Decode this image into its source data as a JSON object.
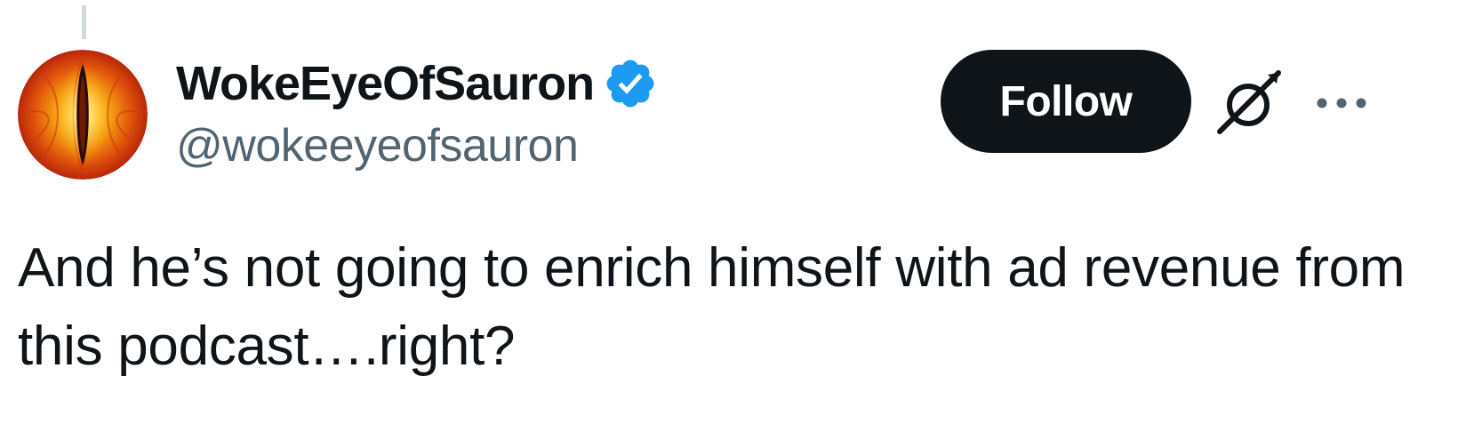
{
  "tweet": {
    "author": {
      "display_name": "WokeEyeOfSauron",
      "handle": "@wokeeyeofsauron",
      "verified": true,
      "avatar_icon": "eye-of-sauron-avatar"
    },
    "actions": {
      "follow_label": "Follow",
      "grok_icon": "grok-icon",
      "more_icon": "more-options-icon"
    },
    "text": "And he’s not going to enrich himself with ad revenue from this podcast….right?"
  },
  "colors": {
    "text_primary": "#0f1419",
    "text_secondary": "#536471",
    "verified_blue": "#1d9bf0",
    "follow_bg": "#0f1419",
    "follow_text": "#ffffff",
    "thread_line": "#cfd9de"
  }
}
